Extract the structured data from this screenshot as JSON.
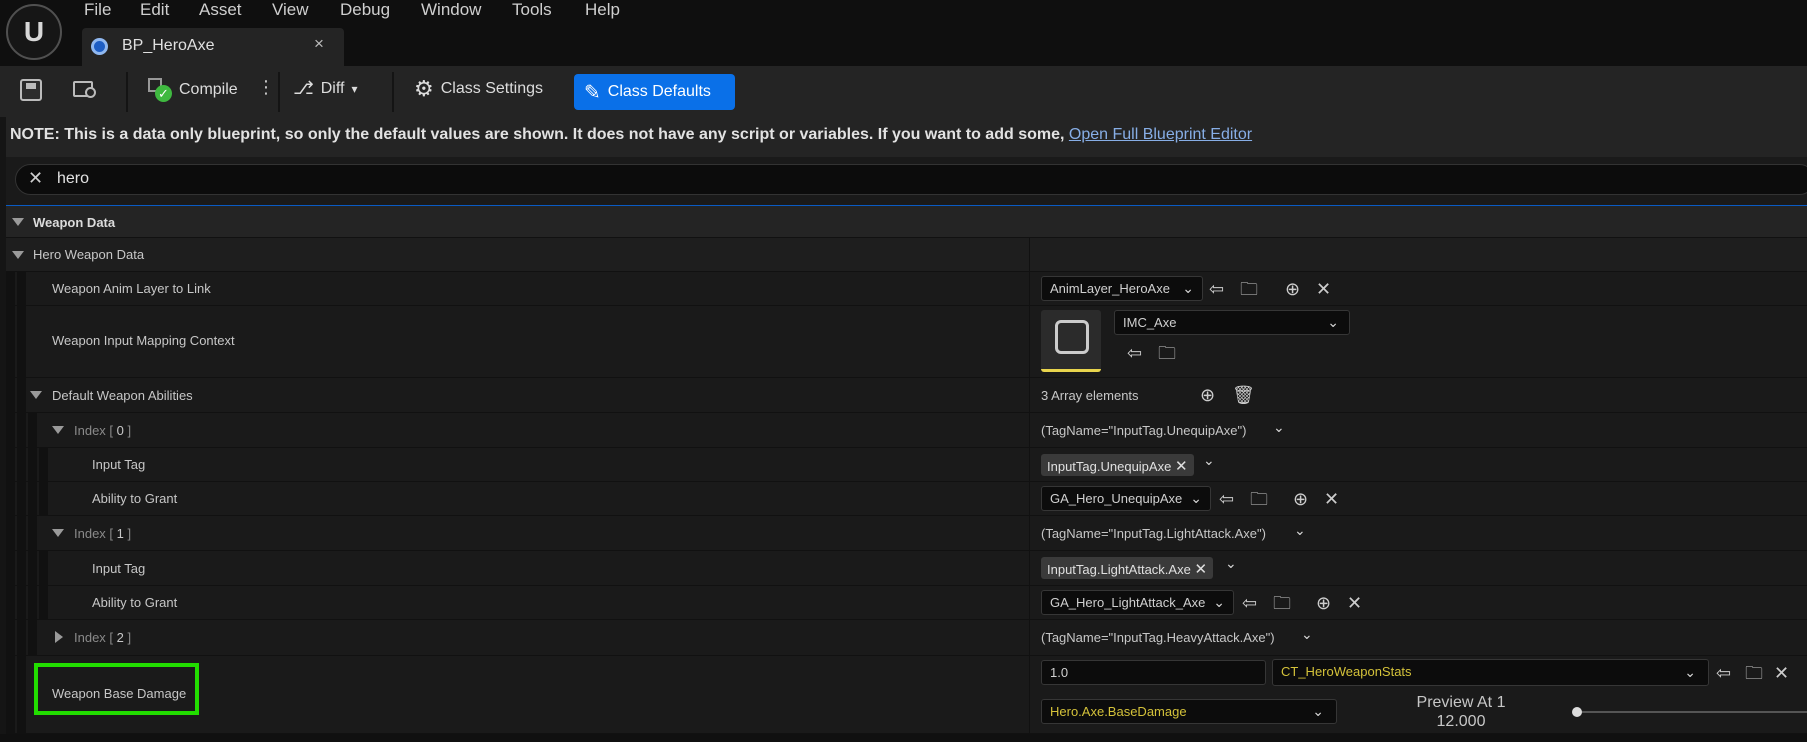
{
  "menu": [
    "File",
    "Edit",
    "Asset",
    "View",
    "Debug",
    "Window",
    "Tools",
    "Help"
  ],
  "tab": {
    "title": "BP_HeroAxe",
    "close": "×"
  },
  "toolbar": {
    "compile": "Compile",
    "diff": "Diff",
    "class_settings": "Class Settings",
    "class_defaults": "Class Defaults"
  },
  "note": {
    "text": "NOTE: This is a data only blueprint, so only the default values are shown.  It does not have any script or variables.  If you want to add some, ",
    "link": "Open Full Blueprint Editor"
  },
  "search": {
    "value": "hero"
  },
  "sections": {
    "weapon_data": "Weapon Data",
    "hero_weapon_data": "Hero Weapon Data"
  },
  "props": {
    "anim_layer": {
      "label": "Weapon Anim Layer to Link",
      "value": "AnimLayer_HeroAxe"
    },
    "input_mapping": {
      "label": "Weapon Input Mapping Context",
      "value": "IMC_Axe"
    },
    "abilities": {
      "label": "Default Weapon Abilities",
      "value": "3 Array elements"
    },
    "index0": {
      "label": "Index",
      "num": "0",
      "value": "(TagName=\"InputTag.UnequipAxe\")",
      "input_tag": "InputTag.UnequipAxe",
      "ability": "GA_Hero_UnequipAxe"
    },
    "index1": {
      "label": "Index",
      "num": "1",
      "value": "(TagName=\"InputTag.LightAttack.Axe\")",
      "input_tag": "InputTag.LightAttack.Axe",
      "ability": "GA_Hero_LightAttack_Axe"
    },
    "index2": {
      "label": "Index",
      "num": "2",
      "value": "(TagName=\"InputTag.HeavyAttack.Axe\")"
    },
    "input_tag_label": "Input Tag",
    "ability_label": "Ability to Grant",
    "base_damage": {
      "label": "Weapon Base Damage",
      "value": "1.0",
      "table": "CT_HeroWeaponStats",
      "row": "Hero.Axe.BaseDamage",
      "preview_label": "Preview At 1",
      "preview_value": "12.000"
    }
  },
  "colors": {
    "accent": "#0a70e8",
    "highlight": "#22dd00",
    "curve_text": "#d4c23a"
  }
}
